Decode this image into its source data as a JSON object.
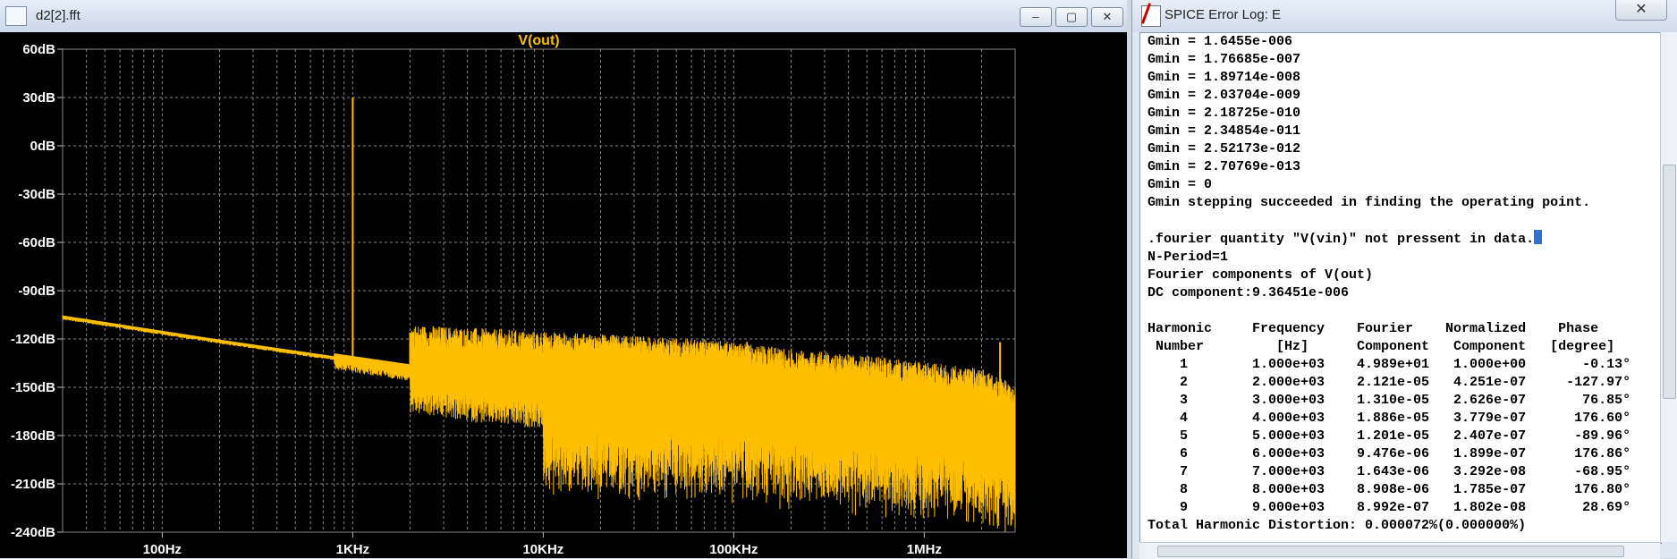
{
  "fft_window": {
    "title": "d2[2].fft",
    "buttons": {
      "minimize": "–",
      "restore": "▢",
      "close": "✕"
    }
  },
  "chart_data": {
    "type": "line",
    "title": "V(out)",
    "xscale": "log",
    "xlim": [
      30,
      3000000
    ],
    "ylim": [
      -240,
      60
    ],
    "x_ticks": [
      {
        "value": 100,
        "label": "100Hz"
      },
      {
        "value": 1000,
        "label": "1KHz"
      },
      {
        "value": 10000,
        "label": "10KHz"
      },
      {
        "value": 100000,
        "label": "100KHz"
      },
      {
        "value": 1000000,
        "label": "1MHz"
      }
    ],
    "y_ticks": [
      {
        "value": 60,
        "label": "60dB"
      },
      {
        "value": 30,
        "label": "30dB"
      },
      {
        "value": 0,
        "label": "0dB"
      },
      {
        "value": -30,
        "label": "-30dB"
      },
      {
        "value": -60,
        "label": "-60dB"
      },
      {
        "value": -90,
        "label": "-90dB"
      },
      {
        "value": -120,
        "label": "-120dB"
      },
      {
        "value": -150,
        "label": "-150dB"
      },
      {
        "value": -180,
        "label": "-180dB"
      },
      {
        "value": -210,
        "label": "-210dB"
      },
      {
        "value": -240,
        "label": "-240dB"
      }
    ],
    "grid": true,
    "series": [
      {
        "name": "V(out)",
        "color": "#ffbf00",
        "noise_floor": [
          [
            30,
            -106
          ],
          [
            200,
            -121
          ],
          [
            1000,
            -133
          ],
          [
            5000,
            -145
          ],
          [
            20000,
            -150
          ],
          [
            100000,
            -152
          ],
          [
            500000,
            -160
          ],
          [
            2000000,
            -168
          ],
          [
            3000000,
            -178
          ]
        ],
        "peaks": [
          {
            "x": 1000,
            "y": 30
          },
          {
            "x": 2000,
            "y": -116
          },
          {
            "x": 3000,
            "y": -122
          },
          {
            "x": 4000,
            "y": -115
          },
          {
            "x": 5000,
            "y": -122
          },
          {
            "x": 6000,
            "y": -124
          },
          {
            "x": 7000,
            "y": -139
          },
          {
            "x": 8000,
            "y": -120
          },
          {
            "x": 9000,
            "y": -140
          },
          {
            "x": 2500000,
            "y": -122
          }
        ]
      }
    ]
  },
  "log_window": {
    "title": "SPICE Error Log: E",
    "close": "✕",
    "lines": [
      "Gmin = 1.6455e-006",
      "Gmin = 1.76685e-007",
      "Gmin = 1.89714e-008",
      "Gmin = 2.03704e-009",
      "Gmin = 2.18725e-010",
      "Gmin = 2.34854e-011",
      "Gmin = 2.52173e-012",
      "Gmin = 2.70769e-013",
      "Gmin = 0",
      "Gmin stepping succeeded in finding the operating point.",
      "",
      ".fourier quantity \"V(vin)\" not pressent in data.",
      "N-Period=1",
      "Fourier components of V(out)",
      "DC component:9.36451e-006",
      "",
      "Harmonic     Frequency    Fourier    Normalized    Phase",
      " Number         [Hz]      Component   Component   [degree]",
      "    1        1.000e+03    4.989e+01   1.000e+00       -0.13°",
      "    2        2.000e+03    2.121e-05   4.251e-07     -127.97°",
      "    3        3.000e+03    1.310e-05   2.626e-07       76.85°",
      "    4        4.000e+03    1.886e-05   3.779e-07      176.60°",
      "    5        5.000e+03    1.201e-05   2.407e-07      -89.96°",
      "    6        6.000e+03    9.476e-06   1.899e-07      176.86°",
      "    7        7.000e+03    1.643e-06   3.292e-08      -68.95°",
      "    8        8.000e+03    8.908e-06   1.785e-07      176.80°",
      "    9        9.000e+03    8.992e-07   1.802e-08       28.69°",
      "Total Harmonic Distortion: 0.000072%(0.000000%)"
    ]
  }
}
